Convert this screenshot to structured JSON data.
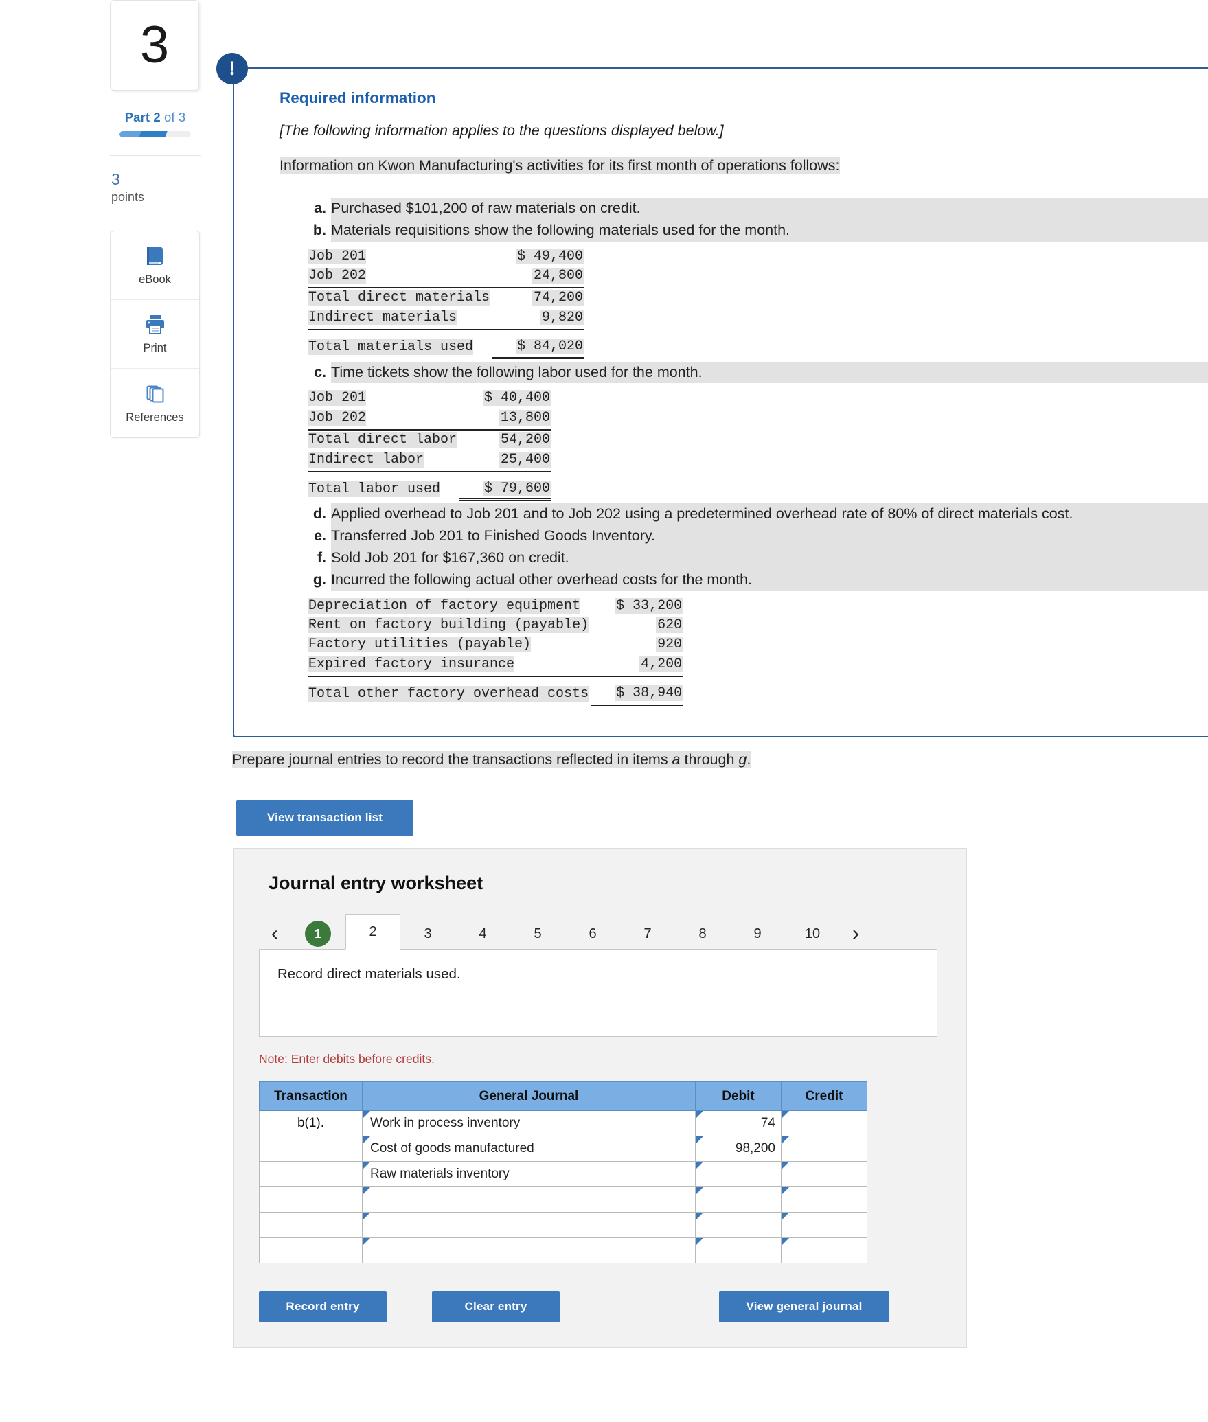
{
  "sidebar": {
    "question_number": "3",
    "part_prefix": "Part",
    "part_current": "2",
    "part_suffix": "of 3",
    "points_value": "3",
    "points_label": "points",
    "tools": [
      {
        "label": "eBook",
        "icon": "ebook-icon"
      },
      {
        "label": "Print",
        "icon": "printer-icon"
      },
      {
        "label": "References",
        "icon": "references-icon"
      }
    ]
  },
  "callout": {
    "badge": "!",
    "title": "Required information",
    "subtitle": "[The following information applies to the questions displayed below.]",
    "intro": "Information on Kwon Manufacturing's activities for its first month of operations follows:",
    "items": {
      "a": "Purchased $101,200 of raw materials on credit.",
      "b": "Materials requisitions show the following materials used for the month.",
      "c": "Time tickets show the following labor used for the month.",
      "d": "Applied overhead to Job 201 and to Job 202 using a predetermined overhead rate of 80% of direct materials cost.",
      "e": "Transferred Job 201 to Finished Goods Inventory.",
      "f": "Sold Job 201 for $167,360 on credit.",
      "g": "Incurred the following actual other overhead costs for the month."
    },
    "materials_table": {
      "rows": [
        {
          "label": "Job 201",
          "value": "$ 49,400"
        },
        {
          "label": "Job 202",
          "value": "24,800"
        },
        {
          "label": "Total direct materials",
          "value": "74,200"
        },
        {
          "label": "Indirect materials",
          "value": "9,820"
        },
        {
          "label": "Total materials used",
          "value": "$ 84,020"
        }
      ]
    },
    "labor_table": {
      "rows": [
        {
          "label": "Job 201",
          "value": "$ 40,400"
        },
        {
          "label": "Job 202",
          "value": "13,800"
        },
        {
          "label": "Total direct labor",
          "value": "54,200"
        },
        {
          "label": "Indirect labor",
          "value": "25,400"
        },
        {
          "label": "Total labor used",
          "value": "$ 79,600"
        }
      ]
    },
    "overhead_table": {
      "rows": [
        {
          "label": "Depreciation of factory equipment",
          "value": "$ 33,200"
        },
        {
          "label": "Rent on factory building (payable)",
          "value": "620"
        },
        {
          "label": "Factory utilities (payable)",
          "value": "920"
        },
        {
          "label": "Expired factory insurance",
          "value": "4,200"
        },
        {
          "label": "Total other factory overhead costs",
          "value": "$ 38,940"
        }
      ]
    }
  },
  "main": {
    "prompt_pre": "Prepare journal entries to record the transactions reflected in items ",
    "prompt_a": "a",
    "prompt_mid": " through ",
    "prompt_g": "g",
    "prompt_end": ".",
    "view_transaction_list": "View transaction list",
    "worksheet_title": "Journal entry worksheet",
    "tabs": {
      "prev": "‹",
      "next": "›",
      "items": [
        "1",
        "2",
        "3",
        "4",
        "5",
        "6",
        "7",
        "8",
        "9",
        "10"
      ],
      "active": "2",
      "completed": [
        "1"
      ]
    },
    "tab_instruction": "Record direct materials used.",
    "note": "Note: Enter debits before credits.",
    "table": {
      "headers": [
        "Transaction",
        "General Journal",
        "Debit",
        "Credit"
      ],
      "rows": [
        {
          "transaction": "b(1).",
          "account": "Work in process inventory",
          "debit": "74",
          "credit": ""
        },
        {
          "transaction": "",
          "account": "Cost of goods manufactured",
          "debit": "98,200",
          "credit": ""
        },
        {
          "transaction": "",
          "account": "Raw materials inventory",
          "debit": "",
          "credit": ""
        },
        {
          "transaction": "",
          "account": "",
          "debit": "",
          "credit": ""
        },
        {
          "transaction": "",
          "account": "",
          "debit": "",
          "credit": ""
        },
        {
          "transaction": "",
          "account": "",
          "debit": "",
          "credit": ""
        }
      ]
    },
    "buttons": {
      "record_entry": "Record entry",
      "clear_entry": "Clear entry",
      "view_general_journal": "View general journal"
    }
  },
  "colors": {
    "accent_blue": "#3b79bc",
    "callout_border": "#2d5c96",
    "table_header_blue": "#7bafe4",
    "note_red": "#b33a3a",
    "tab_done_green": "#3c7a3c"
  }
}
